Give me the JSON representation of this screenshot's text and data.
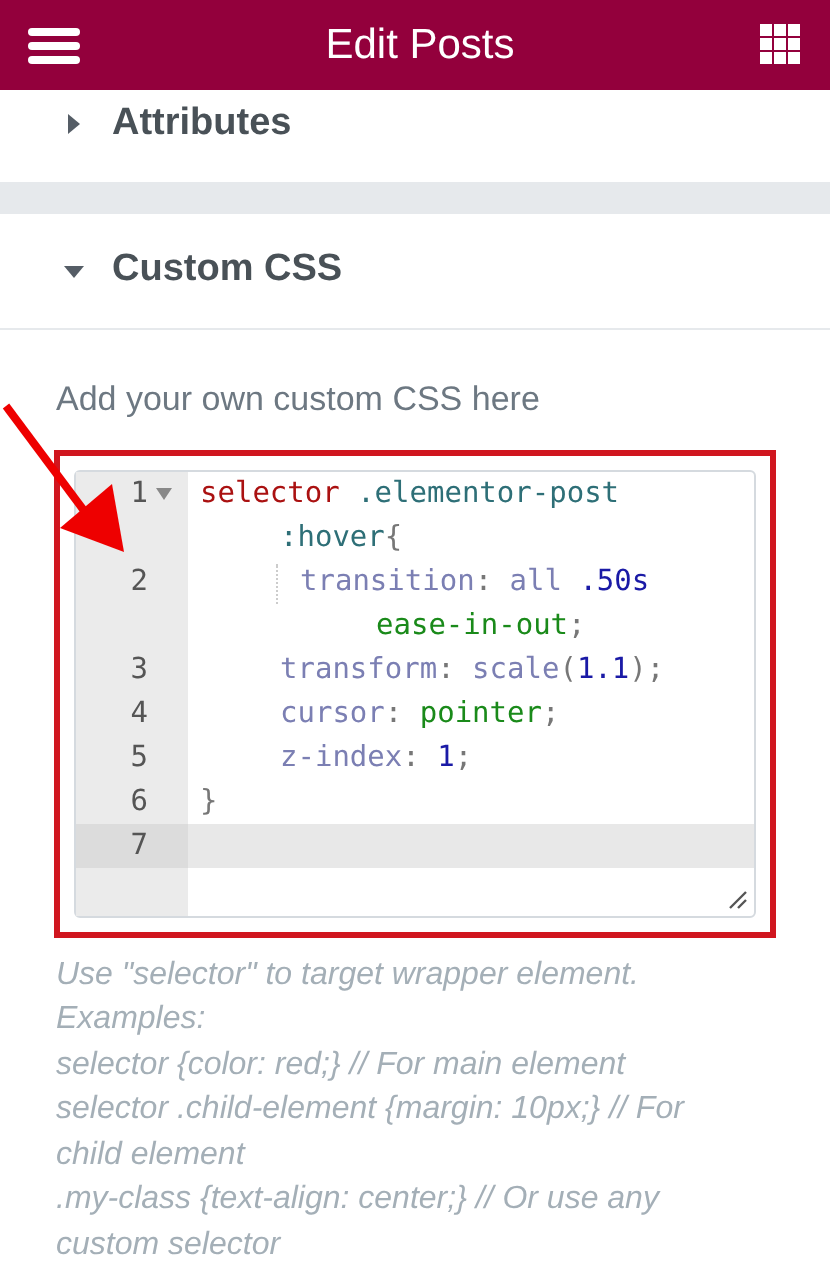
{
  "header": {
    "title": "Edit Posts"
  },
  "sections": [
    {
      "title": "Attributes",
      "expanded": false
    },
    {
      "title": "Custom CSS",
      "expanded": true
    }
  ],
  "custom_css": {
    "label": "Add your own custom CSS here",
    "editor": {
      "lines": [
        {
          "number": "1",
          "fold": true,
          "active": false,
          "indented": false,
          "guide": false,
          "wraps": [
            {
              "tokens": [
                {
                  "kind": "selector",
                  "text": "selector "
                },
                {
                  "kind": "class",
                  "text": ".elementor-post"
                }
              ]
            },
            {
              "tokens": [
                {
                  "kind": "class",
                  "text": ":hover"
                },
                {
                  "kind": "punct",
                  "text": "{"
                }
              ]
            }
          ]
        },
        {
          "number": "2",
          "fold": false,
          "active": false,
          "indented": true,
          "guide": true,
          "wraps": [
            {
              "tokens": [
                {
                  "kind": "property",
                  "text": "transition"
                },
                {
                  "kind": "punct",
                  "text": ": "
                },
                {
                  "kind": "property",
                  "text": "all "
                },
                {
                  "kind": "number",
                  "text": ".50s"
                }
              ]
            },
            {
              "tokens": [
                {
                  "kind": "value",
                  "text": "ease-in-out"
                },
                {
                  "kind": "punct",
                  "text": ";"
                }
              ]
            }
          ]
        },
        {
          "number": "3",
          "fold": false,
          "active": false,
          "indented": true,
          "guide": false,
          "wraps": [
            {
              "tokens": [
                {
                  "kind": "property",
                  "text": "transform"
                },
                {
                  "kind": "punct",
                  "text": ": "
                },
                {
                  "kind": "property",
                  "text": "scale"
                },
                {
                  "kind": "punct",
                  "text": "("
                },
                {
                  "kind": "number",
                  "text": "1.1"
                },
                {
                  "kind": "punct",
                  "text": ");"
                }
              ]
            }
          ]
        },
        {
          "number": "4",
          "fold": false,
          "active": false,
          "indented": true,
          "guide": false,
          "wraps": [
            {
              "tokens": [
                {
                  "kind": "property",
                  "text": "cursor"
                },
                {
                  "kind": "punct",
                  "text": ": "
                },
                {
                  "kind": "value",
                  "text": "pointer"
                },
                {
                  "kind": "punct",
                  "text": ";"
                }
              ]
            }
          ]
        },
        {
          "number": "5",
          "fold": false,
          "active": false,
          "indented": true,
          "guide": false,
          "wraps": [
            {
              "tokens": [
                {
                  "kind": "property",
                  "text": "z-index"
                },
                {
                  "kind": "punct",
                  "text": ": "
                },
                {
                  "kind": "number",
                  "text": "1"
                },
                {
                  "kind": "punct",
                  "text": ";"
                }
              ]
            }
          ]
        },
        {
          "number": "6",
          "fold": false,
          "active": false,
          "indented": false,
          "guide": false,
          "wraps": [
            {
              "tokens": [
                {
                  "kind": "punct",
                  "text": "}"
                }
              ]
            }
          ]
        },
        {
          "number": "7",
          "fold": false,
          "active": true,
          "indented": false,
          "guide": false
        }
      ]
    },
    "help": [
      "Use \"selector\" to target wrapper element. Examples:",
      "selector {color: red;} // For main element",
      "selector .child-element {margin: 10px;} // For child element",
      ".my-class {text-align: center;} // Or use any custom selector"
    ]
  }
}
